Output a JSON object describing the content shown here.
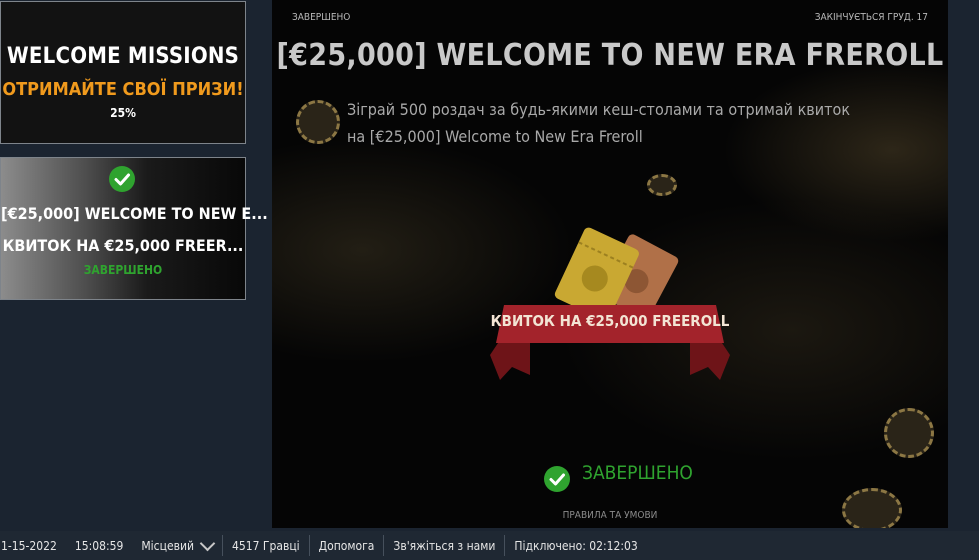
{
  "missions": {
    "welcome": {
      "title": "WELCOME MISSIONS",
      "subtitle": "ОТРИМАЙТЕ СВОЇ ПРИЗИ!",
      "progress": "25%"
    },
    "current": {
      "line1": "[€25,000] WELCOME TO NEW E...",
      "line2": "КВИТОК НА €25,000 FREER...",
      "status": "ЗАВЕРШЕНО"
    }
  },
  "panel": {
    "status": "ЗАВЕРШЕНО",
    "ends": "ЗАКІНЧУЄТЬСЯ ГРУД. 17",
    "title": "[€25,000] WELCOME TO NEW ERA FREROLL",
    "description": "Зіграй 500 роздач за будь-якими кеш-столами та отримай квиток на [€25,000] Welcome to New Era Freroll",
    "prize_label": "КВИТОК НА €25,000 FREEROLL",
    "completed_label": "ЗАВЕРШЕНО",
    "rules_link": "ПРАВИЛА ТА УМОВИ"
  },
  "status_bar": {
    "date": "1-15-2022",
    "time": "15:08:59",
    "timezone": "Місцевий",
    "players": "4517 Гравці",
    "help": "Допомога",
    "contact": "Зв'яжіться з нами",
    "connected": "Підключено: 02:12:03"
  },
  "colors": {
    "accent_orange": "#f09a1d",
    "success_green": "#2fa32f",
    "ribbon_red": "#a3232b",
    "background": "#1b2430"
  }
}
